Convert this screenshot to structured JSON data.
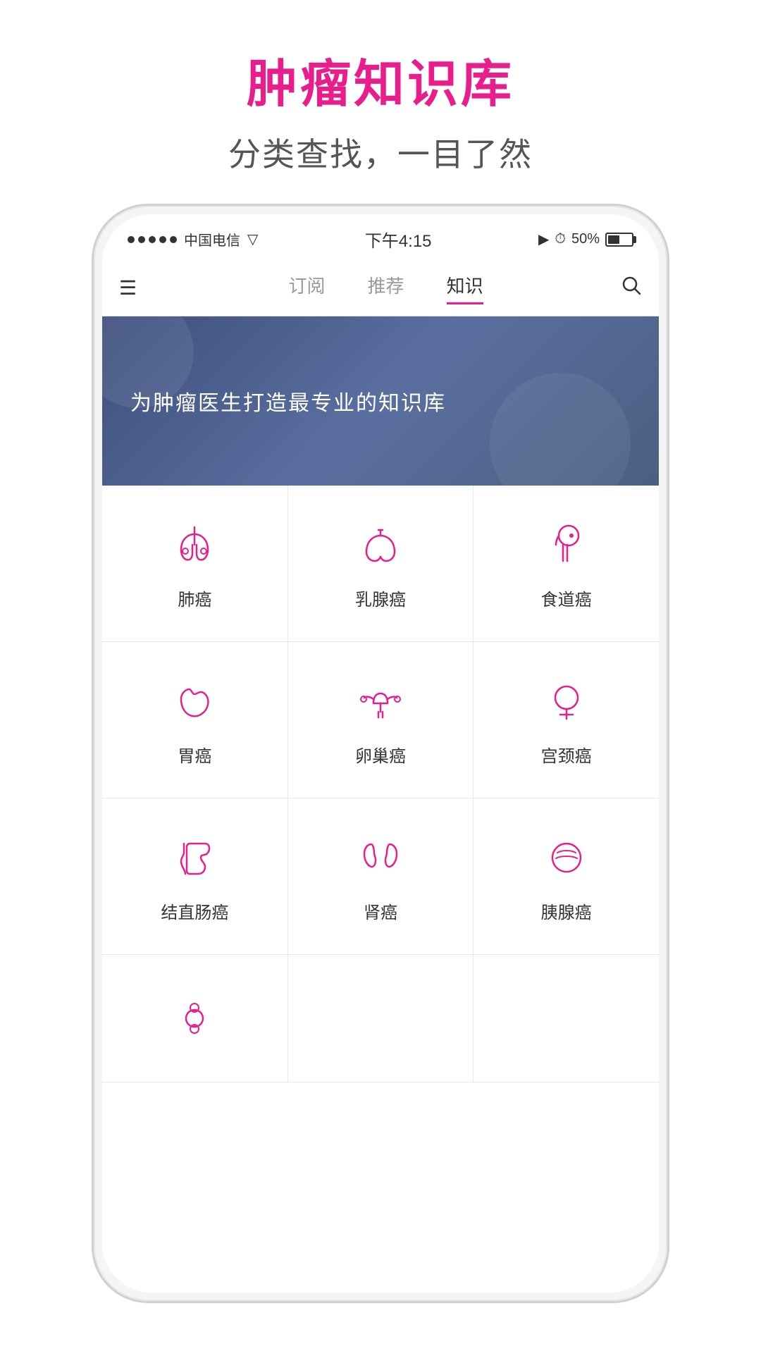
{
  "page": {
    "title": "肿瘤知识库",
    "subtitle": "分类查找，一目了然"
  },
  "status_bar": {
    "carrier": "中国电信",
    "wifi": "WiFi",
    "time": "下午4:15",
    "battery": "50%"
  },
  "nav": {
    "tabs": [
      {
        "label": "订阅",
        "active": false
      },
      {
        "label": "推荐",
        "active": false
      },
      {
        "label": "知识",
        "active": true
      }
    ]
  },
  "hero": {
    "text": "为肿瘤医生打造最专业的知识库"
  },
  "grid": {
    "rows": [
      [
        {
          "label": "肺癌",
          "icon": "lung"
        },
        {
          "label": "乳腺癌",
          "icon": "breast"
        },
        {
          "label": "食道癌",
          "icon": "esophagus"
        }
      ],
      [
        {
          "label": "胃癌",
          "icon": "stomach"
        },
        {
          "label": "卵巢癌",
          "icon": "ovary"
        },
        {
          "label": "宫颈癌",
          "icon": "cervix"
        }
      ],
      [
        {
          "label": "结直肠癌",
          "icon": "colon"
        },
        {
          "label": "肾癌",
          "icon": "kidney"
        },
        {
          "label": "胰腺癌",
          "icon": "pancreas"
        }
      ],
      [
        {
          "label": "",
          "icon": "lymph"
        },
        null,
        null
      ]
    ]
  }
}
